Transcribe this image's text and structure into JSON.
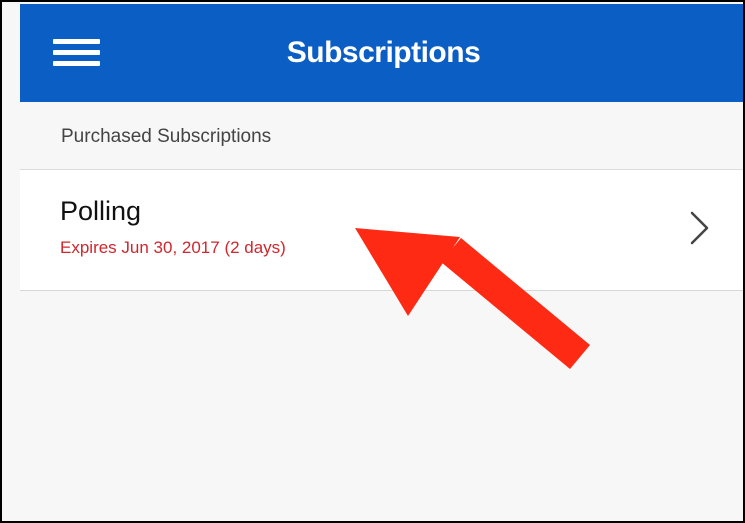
{
  "header": {
    "title": "Subscriptions",
    "bg_color": "#0a5ec4",
    "menu_icon": "hamburger-menu-icon"
  },
  "section": {
    "label": "Purchased Subscriptions"
  },
  "subscriptions": [
    {
      "name": "Polling",
      "expiry": "Expires Jun 30, 2017 (2 days)",
      "expiry_color": "#d0262d",
      "chevron_icon": "chevron-right-icon"
    }
  ],
  "annotation": {
    "type": "arrow",
    "color": "#ff2a14",
    "target": "subscription-row"
  }
}
